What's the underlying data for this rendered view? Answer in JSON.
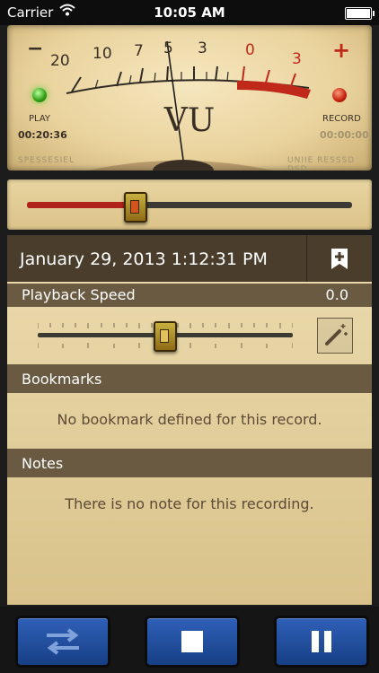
{
  "status_bar": {
    "carrier": "Carrier",
    "time": "10:05 AM",
    "battery_level": 1.0
  },
  "vu_meter": {
    "scale_labels": [
      "20",
      "10",
      "7",
      "5",
      "3",
      "0",
      "3"
    ],
    "minus_sign": "−",
    "plus_sign": "+",
    "vu_label": "VU",
    "play": {
      "label": "PLAY",
      "time": "00:20:36"
    },
    "record": {
      "label": "RECORD",
      "time": "00:00:00"
    },
    "brand_left": "SPESSESIEL",
    "brand_right": "UNIIE RESSSD DSD"
  },
  "playback_position": 0.33,
  "recording": {
    "date": "January 29, 2013 1:12:31 PM"
  },
  "playback_speed": {
    "label": "Playback Speed",
    "value": "0.0",
    "slider_position": 0.5
  },
  "bookmarks": {
    "title": "Bookmarks",
    "empty_text": "No bookmark defined for this record."
  },
  "notes": {
    "title": "Notes",
    "empty_text": "There is no note for this recording."
  },
  "toolbar": {
    "icons": [
      "shuffle-arrows-icon",
      "stop-icon",
      "pause-icon"
    ]
  },
  "colors": {
    "accent_red": "#c0281a",
    "button_blue": "#2458b0",
    "header_brown": "#4a3d2c"
  }
}
